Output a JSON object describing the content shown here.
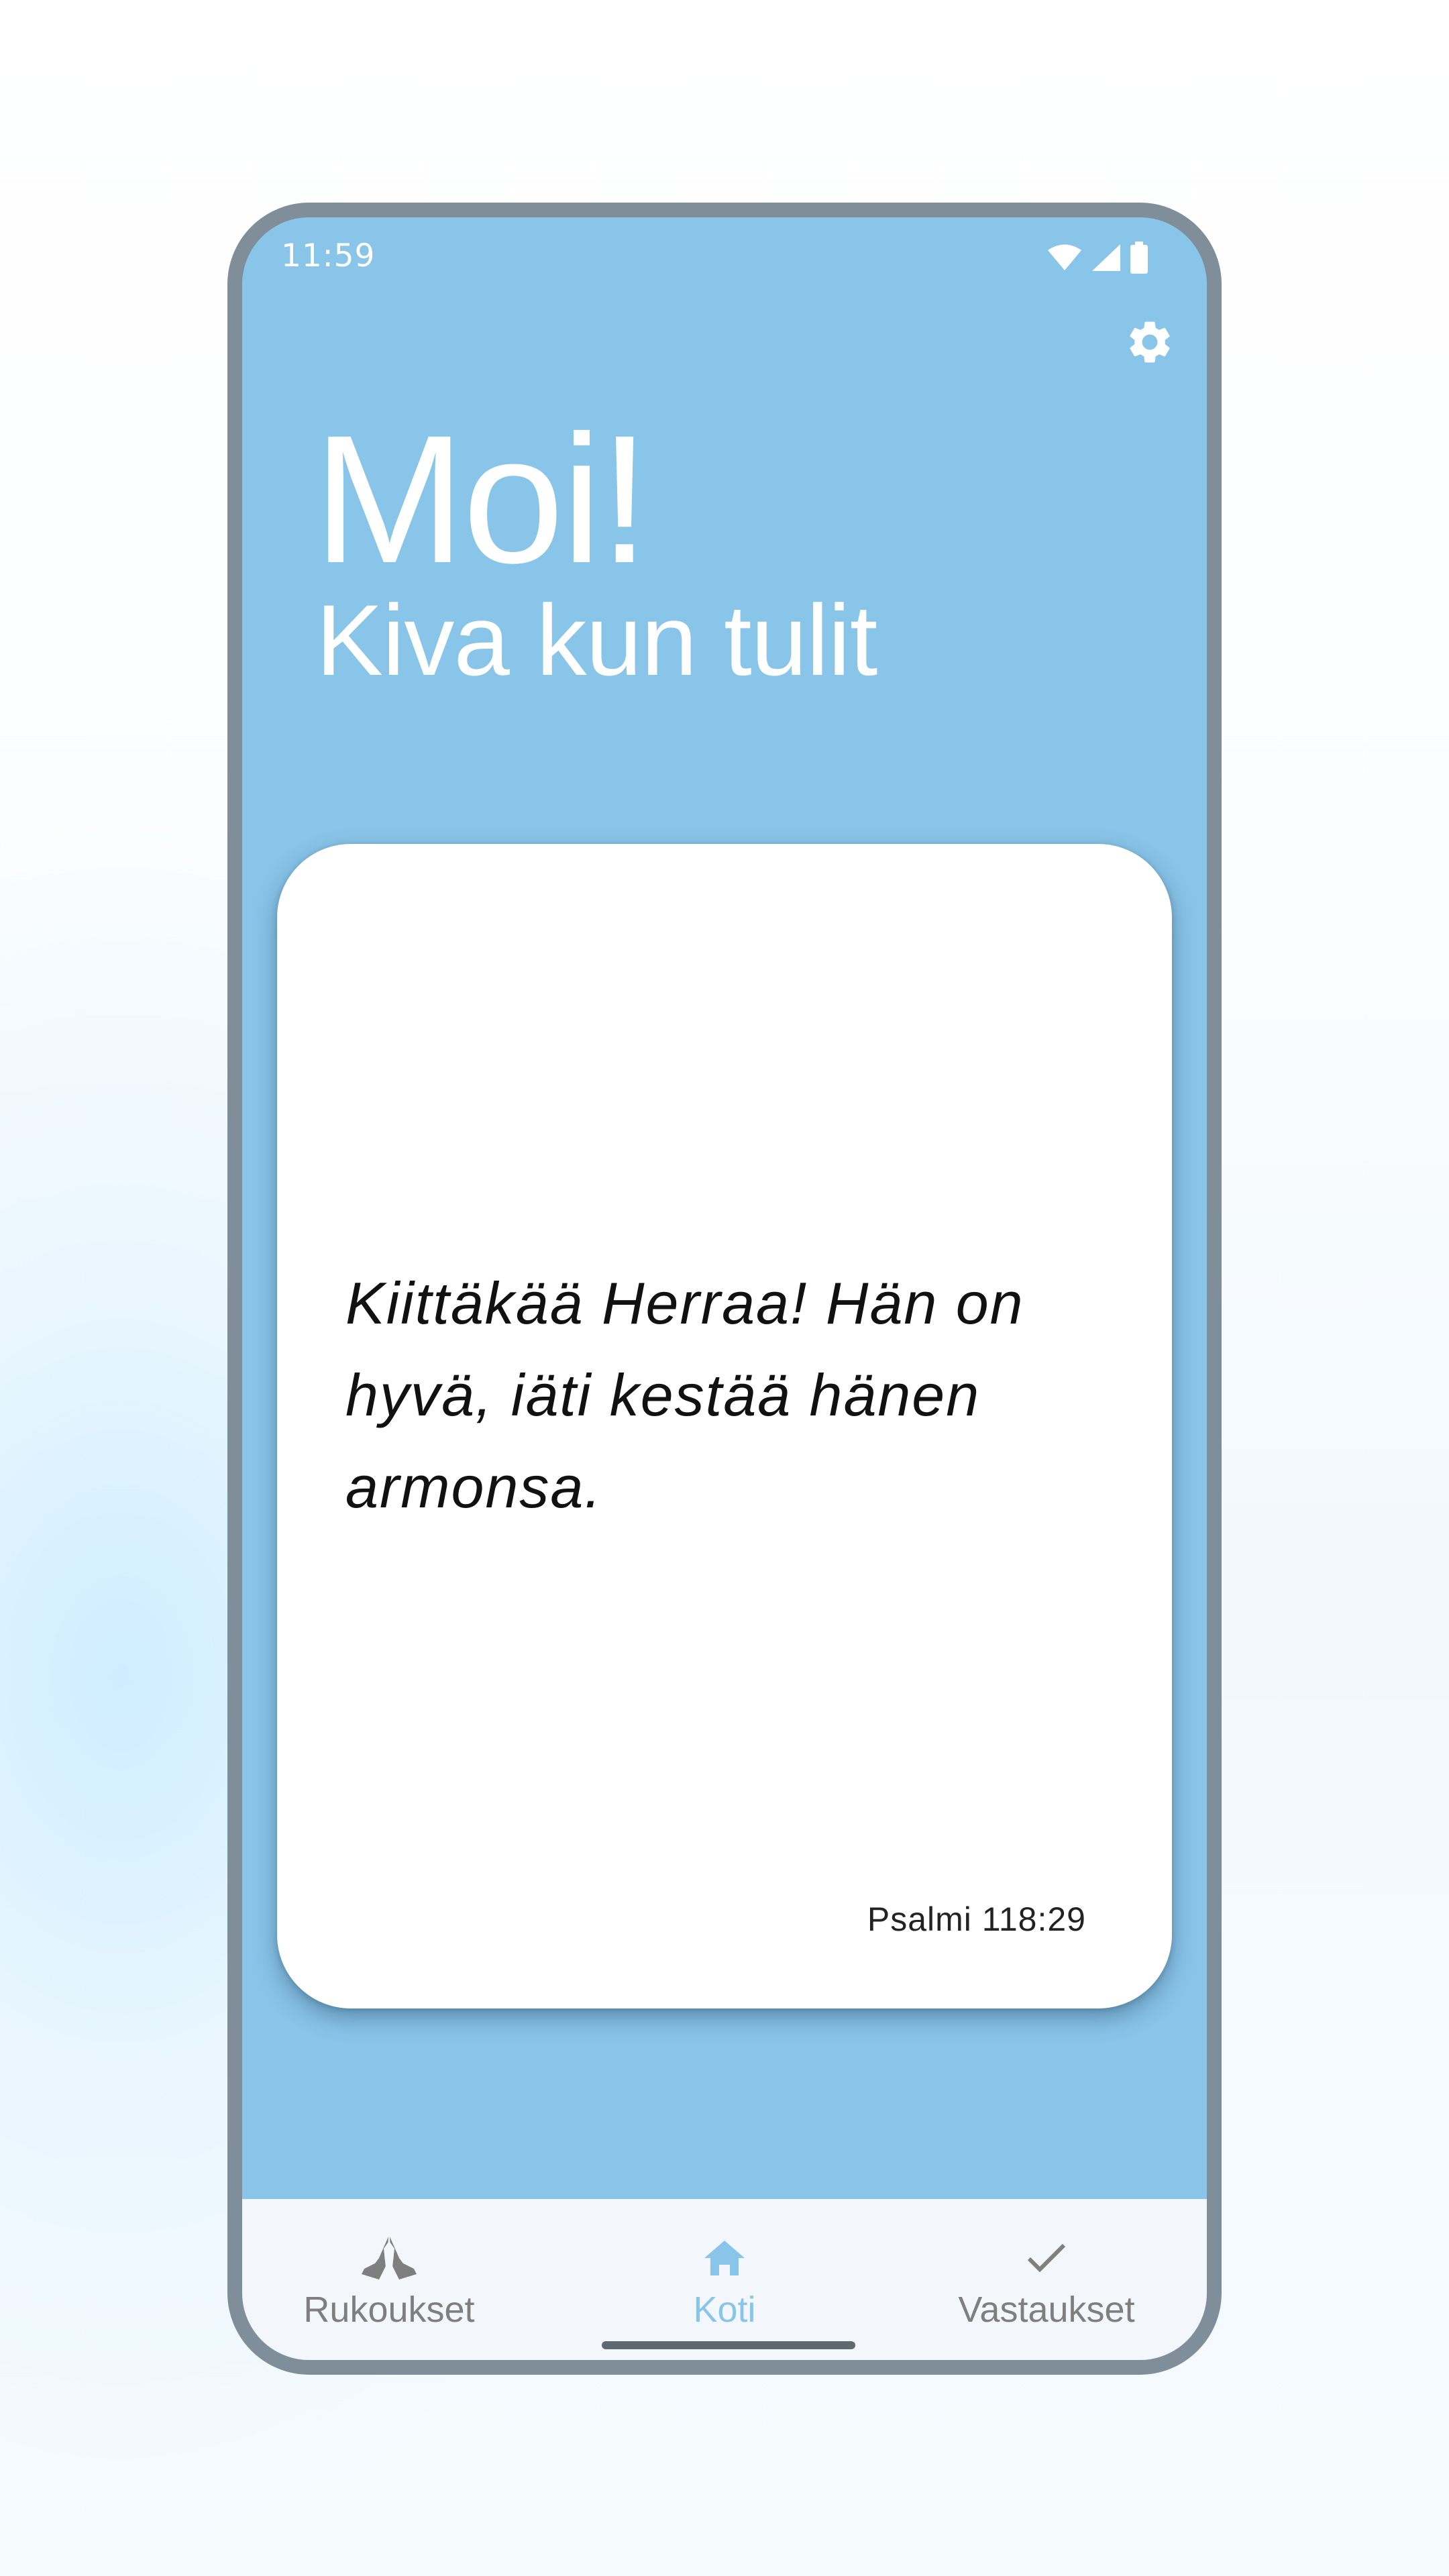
{
  "status_bar": {
    "time": "11:59",
    "icons": [
      "wifi-icon",
      "cell-signal-icon",
      "battery-icon"
    ]
  },
  "header": {
    "settings_icon": "gear-icon",
    "greeting": "Moi!",
    "subtitle": "Kiva kun tulit"
  },
  "verse_card": {
    "text": "Kiittäkää Herraa! Hän on hyvä, iäti kestää hänen armonsa.",
    "reference": "Psalmi 118:29"
  },
  "bottom_nav": {
    "items": [
      {
        "label": "Rukoukset",
        "icon": "praying-hands-icon",
        "active": false
      },
      {
        "label": "Koti",
        "icon": "home-icon",
        "active": true
      },
      {
        "label": "Vastaukset",
        "icon": "check-icon",
        "active": false
      }
    ]
  },
  "colors": {
    "accent": "#89c5e9",
    "phone_frame": "#808e9a",
    "nav_background": "#f3f6fb",
    "inactive": "#7f7f7f",
    "card": "#ffffff"
  }
}
